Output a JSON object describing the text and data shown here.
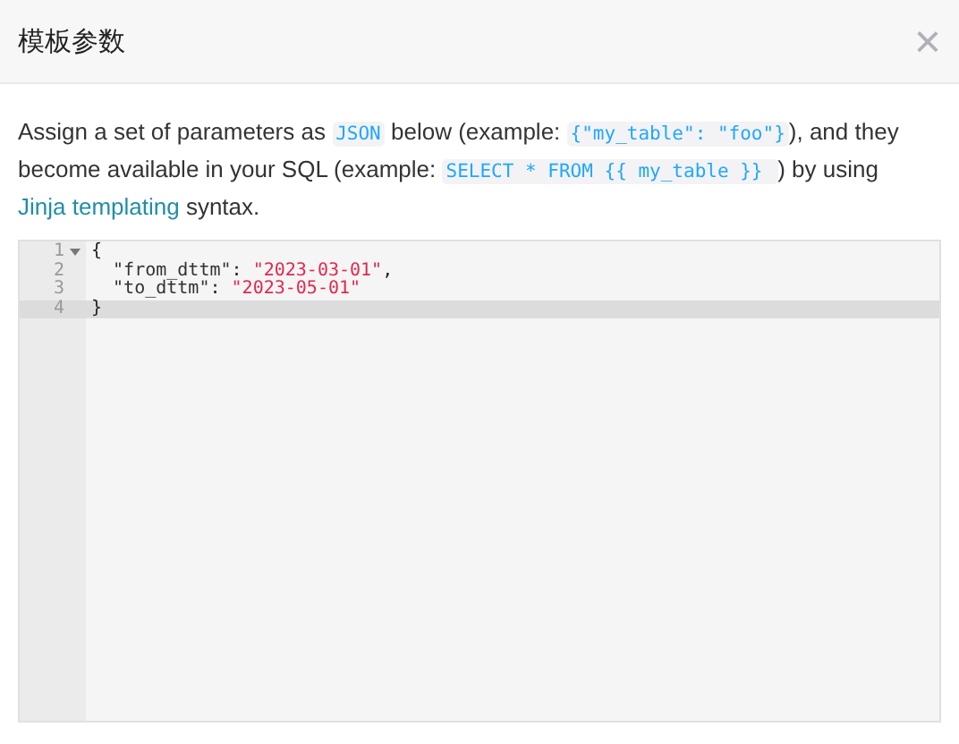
{
  "dialog": {
    "title": "模板参数",
    "close_icon": "×"
  },
  "description": [
    {
      "kind": "text",
      "text": "Assign a set of parameters as "
    },
    {
      "kind": "code",
      "text": "JSON"
    },
    {
      "kind": "text",
      "text": " below (example: "
    },
    {
      "kind": "code",
      "text": "{\"my_table\": \"foo\"}"
    },
    {
      "kind": "text",
      "text": "), and they become available in your SQL (example: "
    },
    {
      "kind": "code",
      "text": "SELECT * FROM {{ my_table }} "
    },
    {
      "kind": "text",
      "text": ") by using "
    },
    {
      "kind": "link",
      "text": "Jinja templating"
    },
    {
      "kind": "text",
      "text": " syntax."
    }
  ],
  "editor": {
    "lines": [
      {
        "number": "1",
        "foldable": true,
        "active": false,
        "tokens": [
          {
            "kind": "punct",
            "text": "{"
          }
        ]
      },
      {
        "number": "2",
        "foldable": false,
        "active": false,
        "tokens": [
          {
            "kind": "key",
            "text": "  \"from_dttm\""
          },
          {
            "kind": "punct",
            "text": ": "
          },
          {
            "kind": "string",
            "text": "\"2023-03-01\""
          },
          {
            "kind": "punct",
            "text": ","
          }
        ]
      },
      {
        "number": "3",
        "foldable": false,
        "active": false,
        "tokens": [
          {
            "kind": "key",
            "text": "  \"to_dttm\""
          },
          {
            "kind": "punct",
            "text": ": "
          },
          {
            "kind": "string",
            "text": "\"2023-05-01\""
          }
        ]
      },
      {
        "number": "4",
        "foldable": false,
        "active": true,
        "tokens": [
          {
            "kind": "punct",
            "text": "}"
          }
        ]
      }
    ]
  }
}
